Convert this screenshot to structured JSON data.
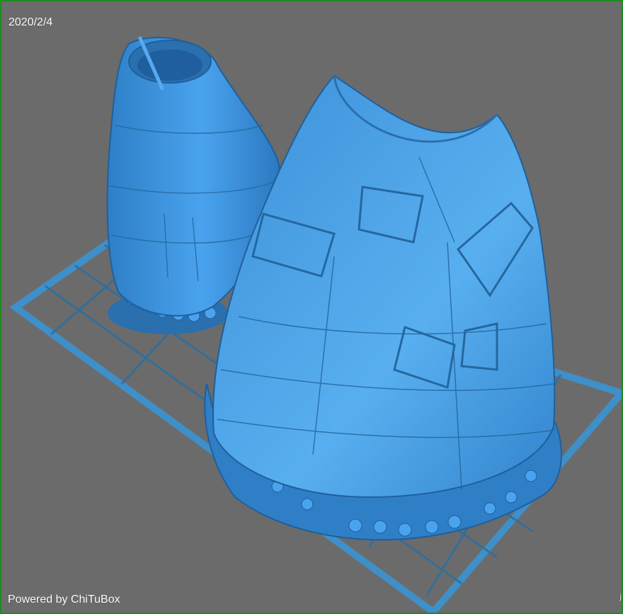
{
  "viewer": {
    "date": "2020/2/4",
    "powered_by": "Powered by ChiTuBox",
    "corner_mark": "j"
  },
  "colors": {
    "background": "#6b6b6b",
    "platform_grid": "#3f8fc8",
    "model_blue": "#3a8fd6",
    "model_light": "#55aaf0",
    "model_dark": "#1f5f9e",
    "frame_border": "#1f8a1f"
  }
}
